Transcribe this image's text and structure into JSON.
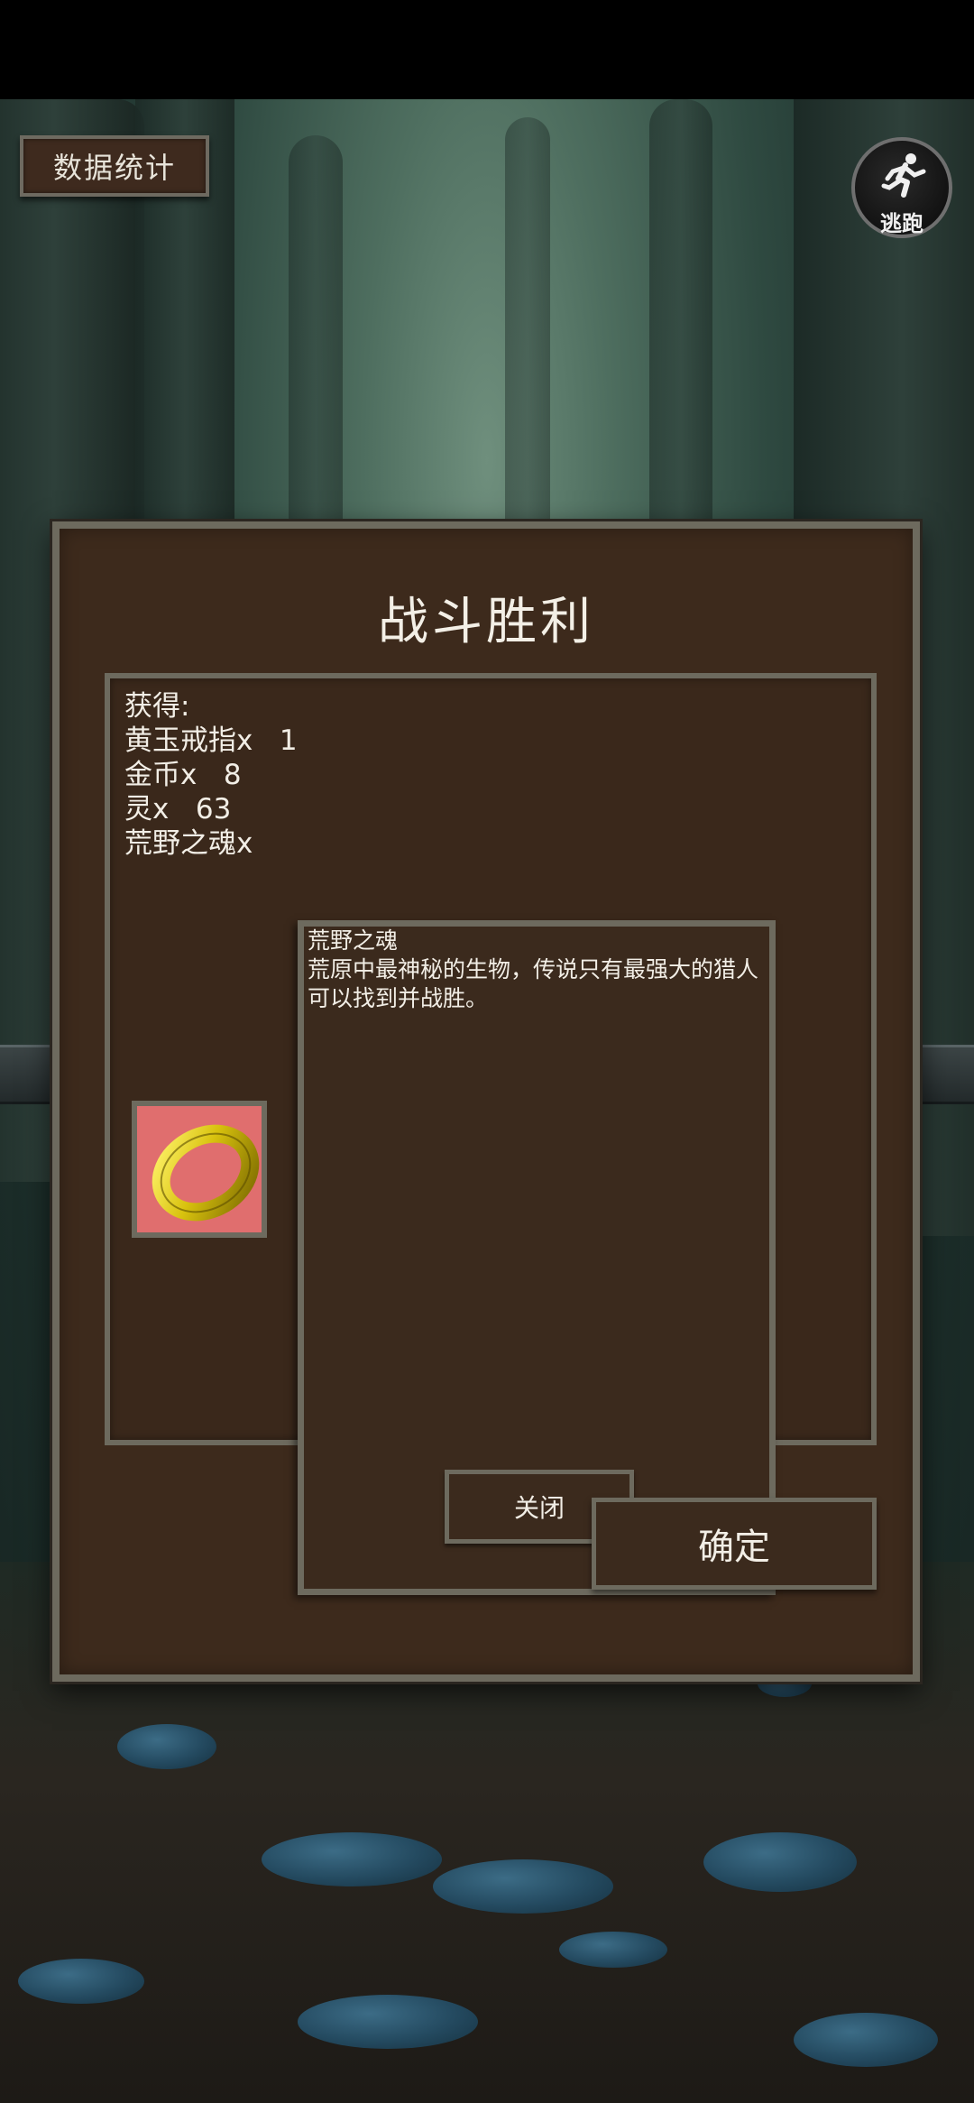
{
  "top_bar": {
    "stats_label": "数据统计",
    "escape_label": "逃跑"
  },
  "dialog": {
    "title": "战斗胜利",
    "loot": {
      "header": "获得:",
      "items": [
        "黄玉戒指x   1",
        "金币x   8",
        "灵x   63",
        "荒野之魂x"
      ]
    },
    "selected_item_icon": "gold-ring-icon",
    "detail": {
      "name": "荒野之魂",
      "description": "荒原中最神秘的生物，传说只有最强大的猎人可以找到并战胜。",
      "close_label": "关闭"
    },
    "confirm_label": "确定"
  },
  "colors": {
    "panel": "#3d2a1c",
    "border": "#6d6a5e",
    "slot_bg": "#e06e6e",
    "text": "#f2eee6"
  }
}
